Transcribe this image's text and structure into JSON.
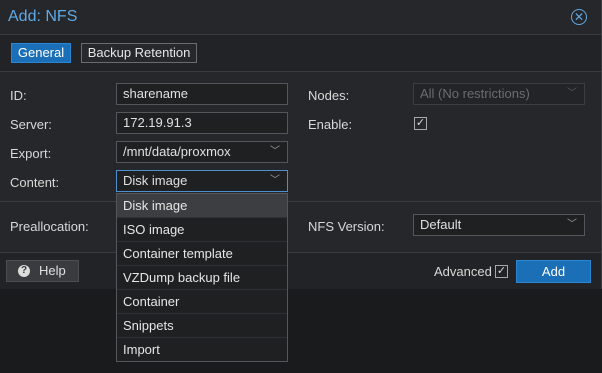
{
  "dialog": {
    "title": "Add: NFS",
    "close_icon": "close-icon"
  },
  "tabs": [
    {
      "label": "General",
      "active": true
    },
    {
      "label": "Backup Retention",
      "active": false
    }
  ],
  "form": {
    "id": {
      "label": "ID:",
      "value": "sharename"
    },
    "server": {
      "label": "Server:",
      "value": "172.19.91.3"
    },
    "export": {
      "label": "Export:",
      "value": "/mnt/data/proxmox"
    },
    "content": {
      "label": "Content:",
      "value": "Disk image"
    },
    "nodes": {
      "label": "Nodes:",
      "value": "All (No restrictions)",
      "disabled": true
    },
    "enable": {
      "label": "Enable:",
      "checked": true
    },
    "preallocation": {
      "label": "Preallocation:"
    },
    "nfs_version": {
      "label": "NFS Version:",
      "value": "Default"
    }
  },
  "content_dropdown": {
    "options": [
      "Disk image",
      "ISO image",
      "Container template",
      "VZDump backup file",
      "Container",
      "Snippets",
      "Import"
    ],
    "selected": "Disk image"
  },
  "footer": {
    "help_label": "Help",
    "help_icon": "question-circle-icon",
    "advanced_label": "Advanced",
    "advanced_checked": true,
    "add_label": "Add"
  },
  "colors": {
    "accent": "#1b6fb7",
    "title": "#5fa9e6",
    "background": "#26272a"
  }
}
